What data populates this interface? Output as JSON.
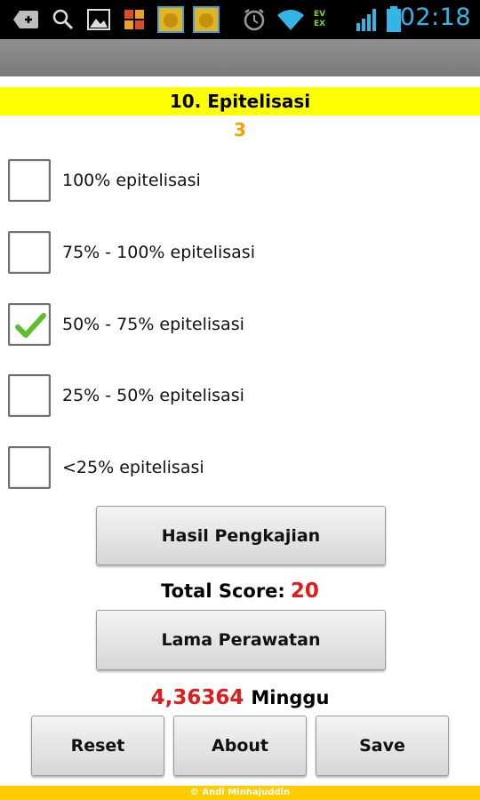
{
  "status_bar": {
    "time": "02:18",
    "network_labels": [
      "EV",
      "EX"
    ],
    "time_color": "#33b5e5"
  },
  "question": {
    "title": "10. Epitelisasi",
    "score": "3"
  },
  "options": [
    {
      "label": "100% epitelisasi",
      "checked": false
    },
    {
      "label": "75% - 100% epitelisasi",
      "checked": false
    },
    {
      "label": "50% - 75% epitelisasi",
      "checked": true
    },
    {
      "label": "25% - 50% epitelisasi",
      "checked": false
    },
    {
      "label": "<25% epitelisasi",
      "checked": false
    }
  ],
  "buttons": {
    "hasil_pengkajian": "Hasil Pengkajian",
    "lama_perawatan": "Lama Perawatan",
    "reset": "Reset",
    "about": "About",
    "save": "Save"
  },
  "total_score": {
    "label": "Total Score:",
    "value": "20"
  },
  "duration": {
    "value": "4,36364",
    "unit": "Minggu"
  },
  "footer": {
    "text": "© Andi Minhajuddin"
  },
  "colors": {
    "title_bg": "#ffff00",
    "score_color": "#f5a000",
    "value_red": "#e21b1b",
    "footer_bg": "#ffcc00",
    "check_green": "#5cbf2a"
  }
}
